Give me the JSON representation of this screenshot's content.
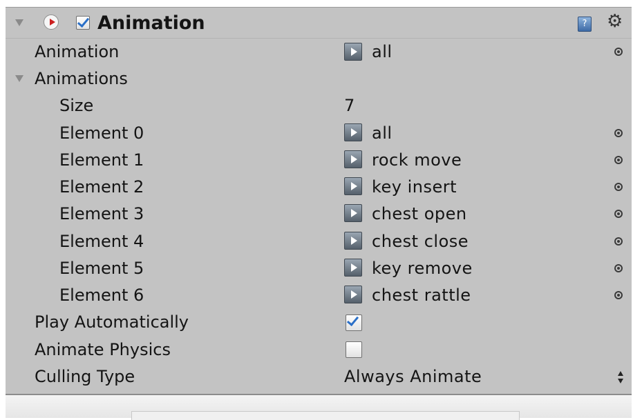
{
  "component": {
    "title": "Animation",
    "enabled": true,
    "help_icon": "help-book-icon",
    "settings_icon": "gear-icon"
  },
  "properties": {
    "animation": {
      "label": "Animation",
      "value": "all"
    },
    "animations": {
      "label": "Animations",
      "expanded": true
    },
    "size": {
      "label": "Size",
      "value": "7"
    },
    "elements": [
      {
        "label": "Element 0",
        "value": "all"
      },
      {
        "label": "Element 1",
        "value": "rock move"
      },
      {
        "label": "Element 2",
        "value": "key insert"
      },
      {
        "label": "Element 3",
        "value": "chest open"
      },
      {
        "label": "Element 4",
        "value": "chest close"
      },
      {
        "label": "Element 5",
        "value": "key remove"
      },
      {
        "label": "Element 6",
        "value": "chest rattle"
      }
    ],
    "play_automatically": {
      "label": "Play Automatically",
      "checked": true
    },
    "animate_physics": {
      "label": "Animate Physics",
      "checked": false
    },
    "culling_type": {
      "label": "Culling Type",
      "value": "Always Animate"
    }
  },
  "colors": {
    "panel_bg": "#c3c3c3",
    "checkmark": "#2a6fc7",
    "text": "#141414"
  }
}
